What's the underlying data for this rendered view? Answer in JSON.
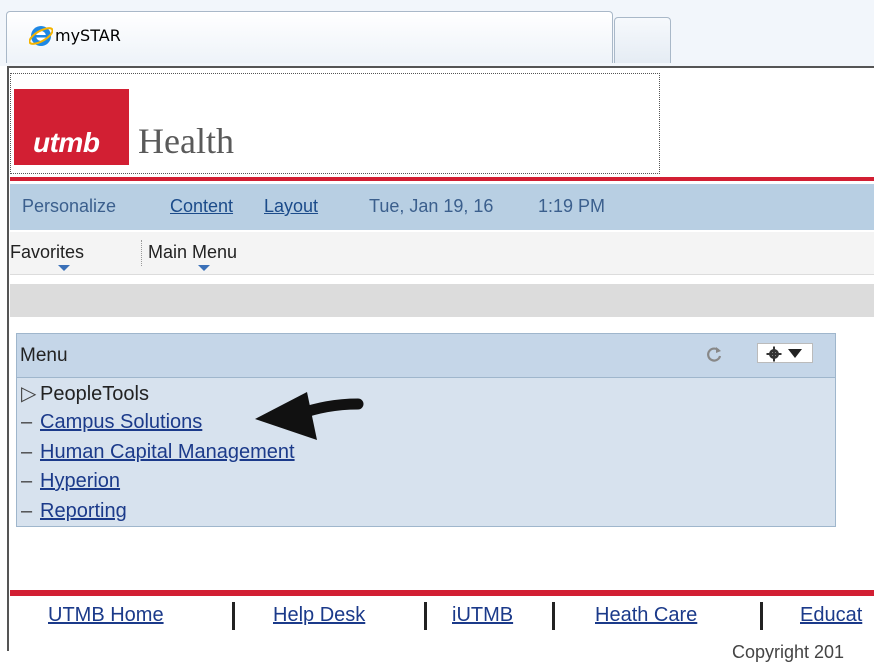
{
  "browser": {
    "tab_title": "mySTAR"
  },
  "header": {
    "logo_utmb": "utmb",
    "logo_health": "Health"
  },
  "personalize_bar": {
    "personalize": "Personalize",
    "content": "Content",
    "layout": "Layout",
    "date": "Tue, Jan 19, 16",
    "time": "1:19 PM"
  },
  "nav": {
    "favorites": "Favorites",
    "main_menu": "Main Menu"
  },
  "menu": {
    "title": "Menu",
    "items": [
      {
        "bullet": "▷",
        "label": "PeopleTools",
        "link": false
      },
      {
        "bullet": "–",
        "label": "Campus Solutions",
        "link": true
      },
      {
        "bullet": "–",
        "label": "Human Capital Management",
        "link": true
      },
      {
        "bullet": "–",
        "label": "Hyperion",
        "link": true
      },
      {
        "bullet": "–",
        "label": "Reporting",
        "link": true
      }
    ]
  },
  "footer": {
    "links": [
      "UTMB Home",
      "Help Desk",
      "iUTMB",
      "Heath Care",
      "Educat"
    ],
    "copyright": "Copyright 201"
  },
  "colors": {
    "brand_red": "#d21f33",
    "bar_blue": "#b8cfe3",
    "link_blue": "#1b3a8a"
  }
}
